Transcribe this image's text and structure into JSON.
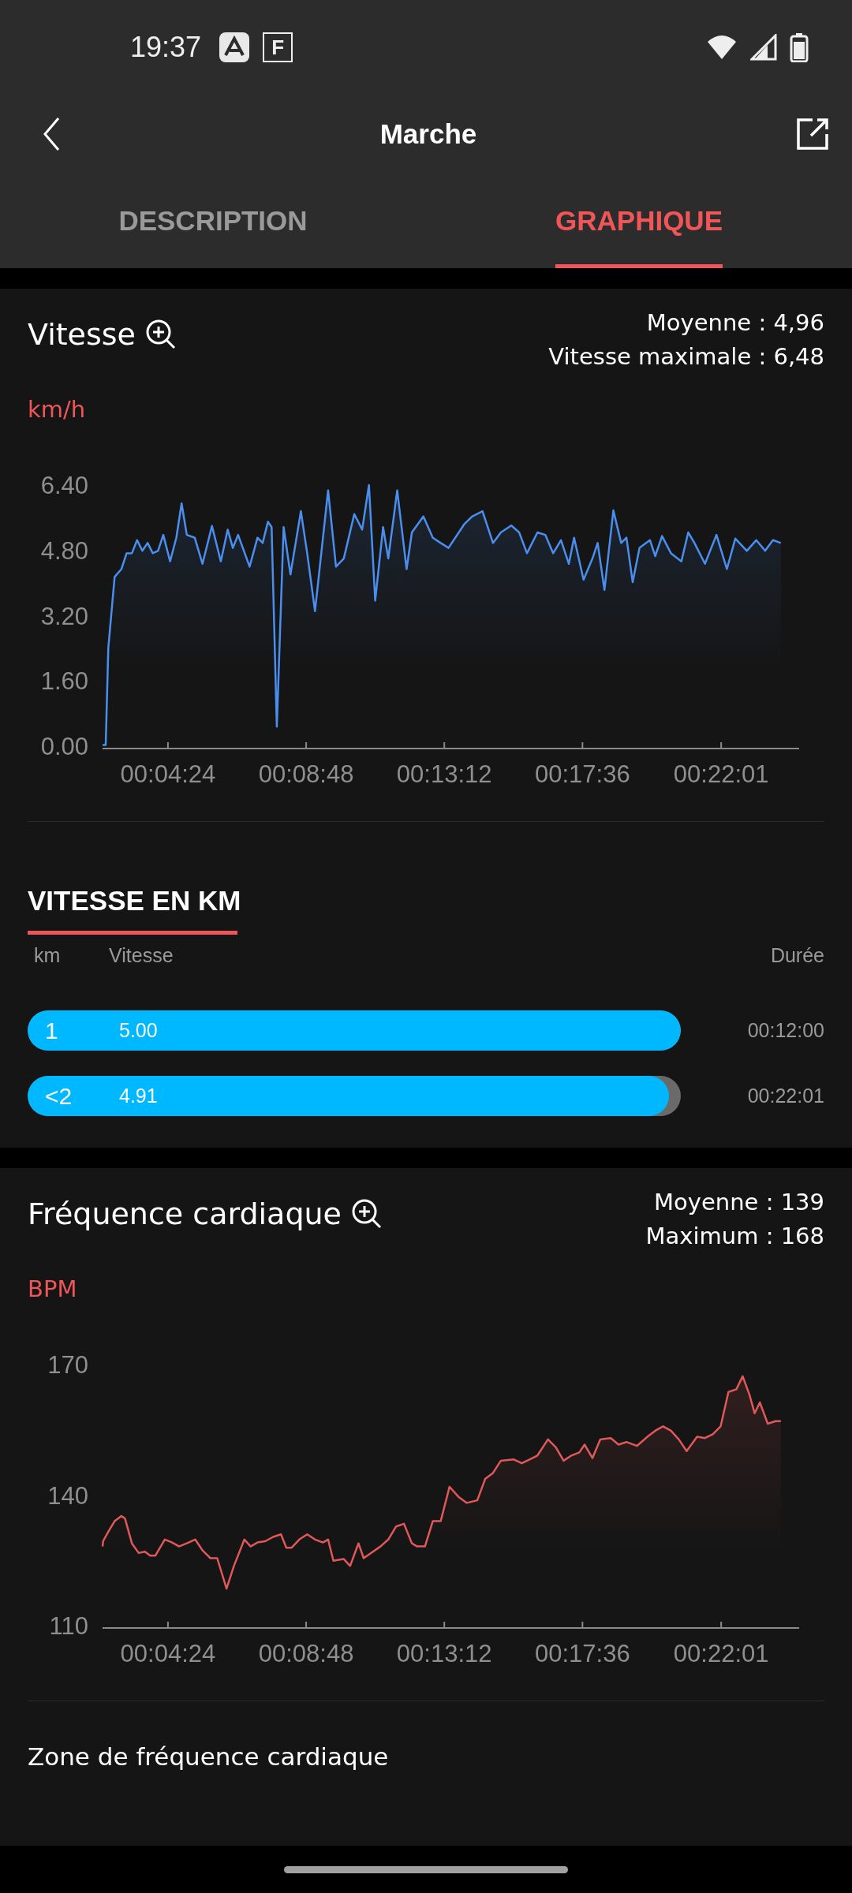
{
  "status_bar": {
    "time": "19:37",
    "app_badge": "F"
  },
  "header": {
    "title": "Marche"
  },
  "tabs": [
    {
      "label": "DESCRIPTION",
      "selected": false
    },
    {
      "label": "GRAPHIQUE",
      "selected": true
    }
  ],
  "speed": {
    "title": "Vitesse",
    "stats": [
      "Moyenne : 4,96",
      "Vitesse maximale : 6,48"
    ],
    "unit": "km/h",
    "chart_data": {
      "type": "area",
      "xlim": [
        139,
        1470
      ],
      "ylim": [
        0,
        6.4
      ],
      "yticks": [
        {
          "value": 0,
          "label": "0.00"
        },
        {
          "value": 1.6,
          "label": "1.60"
        },
        {
          "value": 3.2,
          "label": "3.20"
        },
        {
          "value": 4.8,
          "label": "4.80"
        },
        {
          "value": 6.4,
          "label": "6.40"
        }
      ],
      "xticks": [
        {
          "value": 264,
          "label": "00:04:24"
        },
        {
          "value": 528,
          "label": "00:08:48"
        },
        {
          "value": 792,
          "label": "00:13:12"
        },
        {
          "value": 1056,
          "label": "00:17:36"
        },
        {
          "value": 1321,
          "label": "00:22:01"
        }
      ],
      "x": [
        139,
        145,
        150,
        162,
        175,
        185,
        195,
        205,
        215,
        225,
        235,
        245,
        255,
        268,
        280,
        290,
        300,
        315,
        330,
        348,
        365,
        378,
        388,
        398,
        420,
        435,
        445,
        455,
        462,
        472,
        485,
        498,
        518,
        530,
        545,
        570,
        585,
        600,
        620,
        635,
        648,
        660,
        675,
        685,
        702,
        720,
        730,
        752,
        770,
        785,
        800,
        830,
        845,
        865,
        885,
        900,
        920,
        935,
        950,
        970,
        985,
        1000,
        1015,
        1030,
        1040,
        1058,
        1075,
        1085,
        1098,
        1115,
        1130,
        1140,
        1152,
        1165,
        1185,
        1195,
        1208,
        1225,
        1245,
        1258,
        1270,
        1290,
        1312,
        1332,
        1348,
        1370,
        1388,
        1405,
        1420,
        1435
      ],
      "series": [
        {
          "color": "#4a8ff0",
          "values": [
            0.03,
            0.03,
            2.41,
            4.15,
            4.34,
            4.73,
            4.73,
            5.05,
            4.79,
            4.98,
            4.73,
            4.79,
            5.18,
            4.53,
            5.11,
            5.95,
            5.18,
            5.11,
            4.47,
            5.4,
            4.53,
            5.31,
            4.86,
            5.18,
            4.4,
            5.11,
            4.98,
            5.5,
            5.37,
            0.48,
            5.37,
            4.21,
            5.76,
            4.73,
            3.31,
            6.27,
            4.4,
            4.6,
            5.69,
            5.31,
            6.4,
            3.57,
            5.37,
            4.6,
            6.27,
            4.34,
            5.24,
            5.63,
            5.11,
            4.98,
            4.86,
            5.44,
            5.63,
            5.76,
            4.98,
            5.24,
            5.41,
            5.24,
            4.73,
            5.24,
            5.18,
            4.73,
            5.05,
            4.47,
            5.11,
            4.08,
            4.6,
            4.98,
            3.83,
            5.78,
            4.98,
            5.11,
            4.02,
            4.86,
            5.05,
            4.66,
            5.15,
            4.73,
            4.53,
            5.24,
            4.98,
            4.47,
            5.18,
            4.34,
            5.09,
            4.79,
            5.05,
            4.79,
            5.05,
            4.98
          ]
        }
      ]
    }
  },
  "km_splits": {
    "title": "VITESSE EN KM",
    "columns": [
      "km",
      "Vitesse",
      "Durée"
    ],
    "rows": [
      {
        "km": "1",
        "speed": "5.00",
        "duration": "00:12:00",
        "level": 1
      },
      {
        "km": "<2",
        "speed": "4.91",
        "duration": "00:22:01",
        "level": 0.982
      }
    ]
  },
  "heart_rate": {
    "title": "Fréquence cardiaque",
    "stats": [
      "Moyenne : 139",
      "Maximum : 168"
    ],
    "unit": "BPM",
    "chart_data": {
      "type": "area",
      "xlim": [
        139,
        1470
      ],
      "ylim": [
        110,
        170
      ],
      "yticks": [
        110,
        140,
        170
      ],
      "xticks": [
        {
          "value": 264,
          "label": "00:04:24"
        },
        {
          "value": 528,
          "label": "00:08:48"
        },
        {
          "value": 792,
          "label": "00:13:12"
        },
        {
          "value": 1056,
          "label": "00:17:36"
        },
        {
          "value": 1321,
          "label": "00:22:01"
        }
      ],
      "x": [
        139,
        140,
        150,
        162,
        175,
        182,
        195,
        208,
        220,
        230,
        240,
        258,
        272,
        285,
        300,
        316,
        330,
        345,
        358,
        376,
        390,
        410,
        422,
        435,
        450,
        465,
        480,
        490,
        500,
        515,
        530,
        545,
        560,
        570,
        580,
        600,
        612,
        628,
        638,
        652,
        670,
        685,
        700,
        715,
        730,
        740,
        755,
        770,
        785,
        802,
        820,
        835,
        855,
        870,
        885,
        900,
        925,
        940,
        955,
        970,
        990,
        1005,
        1020,
        1035,
        1050,
        1060,
        1075,
        1090,
        1110,
        1125,
        1140,
        1160,
        1180,
        1195,
        1210,
        1225,
        1240,
        1255,
        1275,
        1290,
        1305,
        1320,
        1335,
        1350,
        1362,
        1375,
        1385,
        1395,
        1410,
        1425,
        1435
      ],
      "series": [
        {
          "color": "#e0585a",
          "values": [
            128.2,
            129.4,
            131.6,
            134,
            135.2,
            134.6,
            128.9,
            126.7,
            127,
            126.1,
            126.1,
            129.8,
            129.1,
            128.2,
            128.9,
            129.8,
            127.3,
            125.5,
            125.5,
            118.5,
            123.7,
            129.8,
            128.2,
            129.1,
            129.4,
            130.4,
            131,
            127.9,
            127.9,
            129.8,
            131,
            129.8,
            129.1,
            129.8,
            124.9,
            125.3,
            123.7,
            128.9,
            125.5,
            126.7,
            128.2,
            129.8,
            132.8,
            133.4,
            128.9,
            128.2,
            128.2,
            134,
            134,
            141.9,
            139.5,
            138.2,
            138.8,
            143.7,
            145.1,
            147.9,
            148.2,
            147.3,
            148.2,
            149.1,
            152.8,
            151,
            147.9,
            149.1,
            149.8,
            151.6,
            148.5,
            152.8,
            153.1,
            151.6,
            152.2,
            151.3,
            153.4,
            154.8,
            155.8,
            154.8,
            152.8,
            150.1,
            153.4,
            153.1,
            154,
            155.8,
            163.7,
            164.3,
            167.3,
            163.1,
            158.8,
            161.3,
            156.4,
            157,
            157
          ]
        }
      ]
    }
  },
  "zone": {
    "title": "Zone de fréquence cardiaque"
  }
}
